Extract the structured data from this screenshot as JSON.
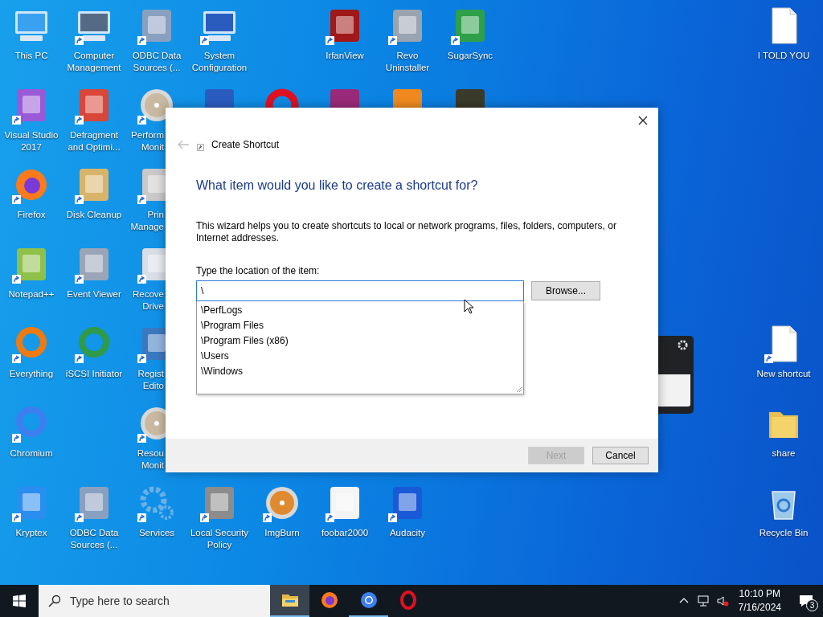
{
  "desktop": {
    "icons": [
      {
        "label": "This PC",
        "shortcut": false
      },
      {
        "label": "Visual Studio 2017",
        "shortcut": true
      },
      {
        "label": "Firefox",
        "shortcut": true
      },
      {
        "label": "Notepad++",
        "shortcut": true
      },
      {
        "label": "Everything",
        "shortcut": true
      },
      {
        "label": "Chromium",
        "shortcut": true
      },
      {
        "label": "Kryptex",
        "shortcut": true
      },
      {
        "label": "Computer Management",
        "shortcut": true
      },
      {
        "label": "Defragment and Optimi...",
        "shortcut": true
      },
      {
        "label": "Disk Cleanup",
        "shortcut": true
      },
      {
        "label": "Event Viewer",
        "shortcut": true
      },
      {
        "label": "iSCSI Initiator",
        "shortcut": true
      },
      {
        "label": "ODBC Data Sources (...",
        "shortcut": true
      },
      {
        "label": "ODBC Data Sources (...",
        "shortcut": true
      },
      {
        "label": "Perform Monit",
        "shortcut": true
      },
      {
        "label": "Prin Manage",
        "shortcut": true
      },
      {
        "label": "Recove Drive",
        "shortcut": true
      },
      {
        "label": "Regist Edito",
        "shortcut": true
      },
      {
        "label": "Resou Monit",
        "shortcut": true
      },
      {
        "label": "Services",
        "shortcut": true
      },
      {
        "label": "System Configuration",
        "shortcut": true
      },
      {
        "label": "Local Security Policy",
        "shortcut": true
      },
      {
        "label": "ImgBurn",
        "shortcut": true
      },
      {
        "label": "IrfanView",
        "shortcut": true
      },
      {
        "label": "foobar2000",
        "shortcut": true
      },
      {
        "label": "Revo Uninstaller",
        "shortcut": true
      },
      {
        "label": "Audacity",
        "shortcut": true
      },
      {
        "label": "SugarSync",
        "shortcut": true
      },
      {
        "label": "I TOLD YOU",
        "shortcut": false
      },
      {
        "label": "New shortcut",
        "shortcut": true
      },
      {
        "label": "share",
        "shortcut": false
      },
      {
        "label": "Recycle Bin",
        "shortcut": false
      }
    ]
  },
  "dialog": {
    "title": "Create Shortcut",
    "back": {
      "disabled": true
    },
    "heading": "What item would you like to create a shortcut for?",
    "description": "This wizard helps you to create shortcuts to local or network programs, files, folders, computers, or Internet addresses.",
    "field_label": "Type the location of the item:",
    "location": "\\",
    "browse_button": "Browse...",
    "suggestions": [
      "\\PerfLogs",
      "\\Program Files",
      "\\Program Files (x86)",
      "\\Users",
      "\\Windows"
    ],
    "buttons": [
      {
        "label": "Next",
        "disabled": true
      },
      {
        "label": "Cancel",
        "disabled": false
      }
    ]
  },
  "taskbar": {
    "search": {
      "placeholder": "Type here to search"
    },
    "apps": [
      {
        "selected": true,
        "running": true
      },
      {
        "selected": false,
        "running": false
      },
      {
        "selected": false,
        "running": true
      },
      {
        "selected": false,
        "running": false
      }
    ],
    "clock": {
      "time": "10:10 PM",
      "date": "7/16/2024"
    },
    "notifications": "3"
  }
}
